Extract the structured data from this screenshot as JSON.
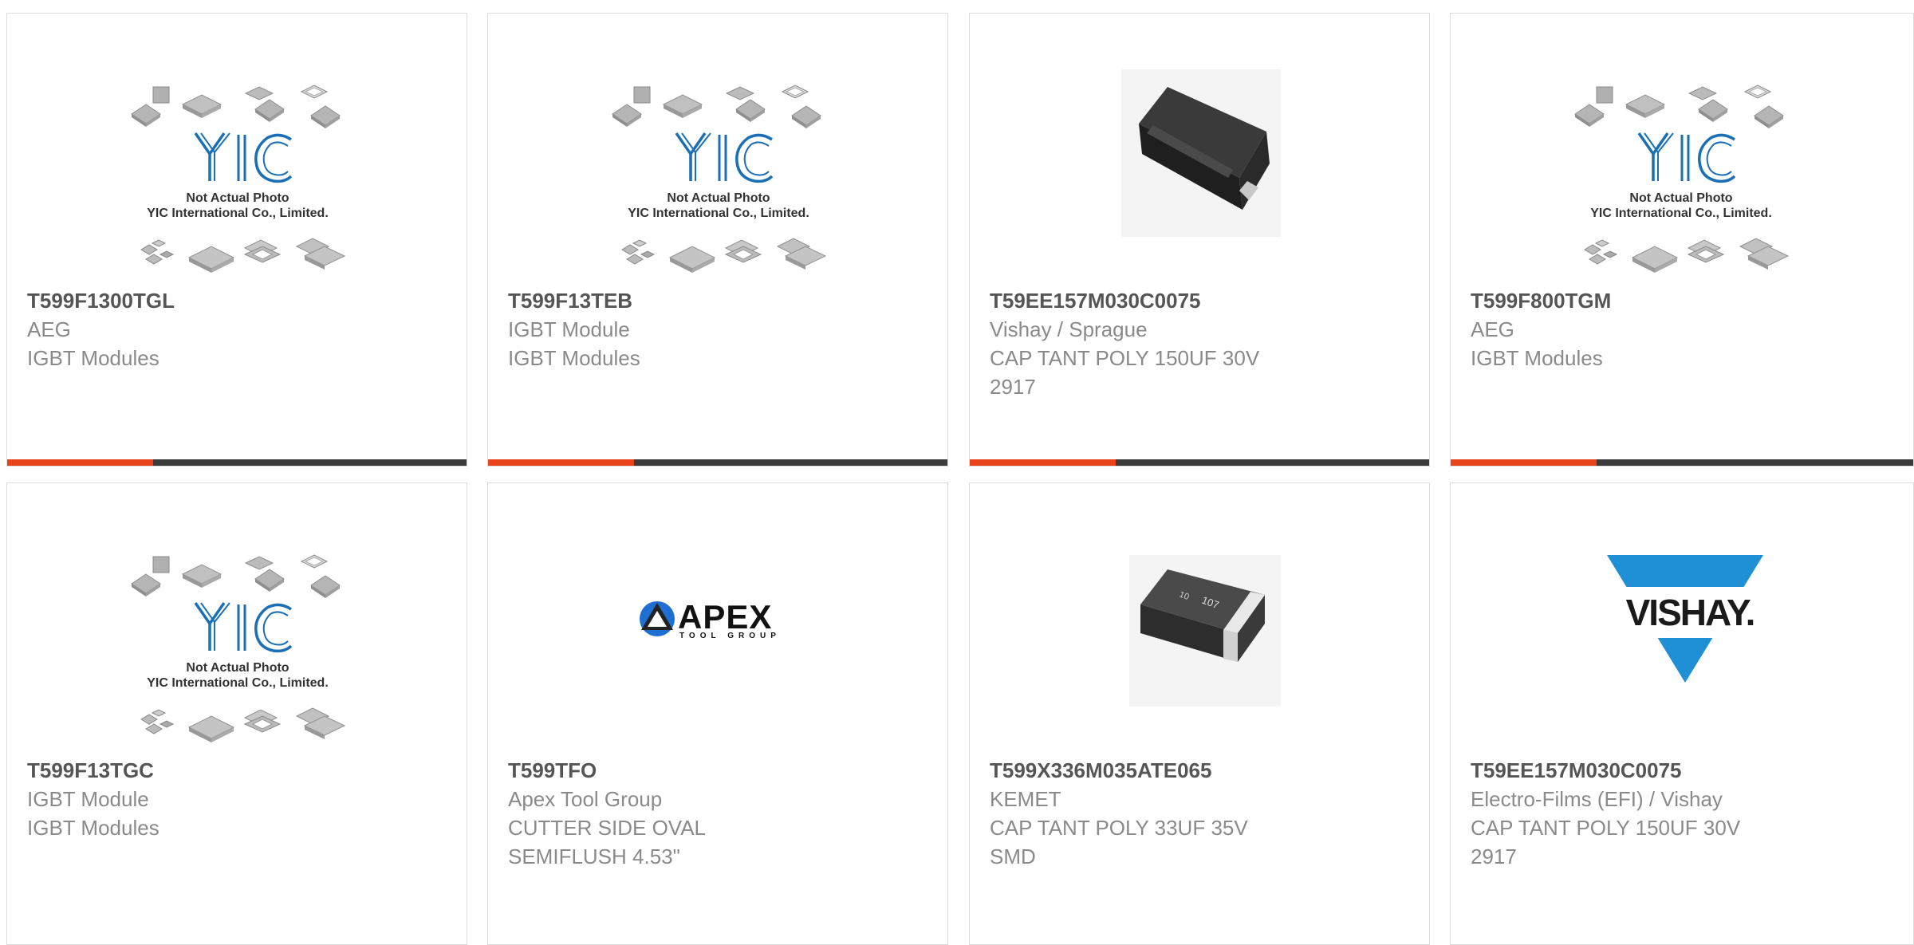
{
  "placeholder": {
    "caption1": "Not Actual Photo",
    "caption2": "YIC International Co., Limited."
  },
  "logos": {
    "apex_word": "APEX",
    "apex_sub": "TOOL GROUP",
    "vishay_word": "VISHAY."
  },
  "colors": {
    "accent": "#e8421a",
    "bar_dark": "#3b3b3b",
    "yic_blue": "#1a6fb5",
    "vishay_blue": "#1f8fd6"
  },
  "products": [
    {
      "part": "T599F1300TGL",
      "line1": "AEG",
      "line2": "IGBT Modules",
      "line3": "",
      "image": "yic-placeholder"
    },
    {
      "part": "T599F13TEB",
      "line1": "IGBT Module",
      "line2": "IGBT Modules",
      "line3": "",
      "image": "yic-placeholder"
    },
    {
      "part": "T59EE157M030C0075",
      "line1": "Vishay / Sprague",
      "line2": "CAP TANT POLY 150UF 30V",
      "line3": "2917",
      "image": "black-smd-capacitor"
    },
    {
      "part": "T599F800TGM",
      "line1": "AEG",
      "line2": "IGBT Modules",
      "line3": "",
      "image": "yic-placeholder"
    },
    {
      "part": "T599F13TGC",
      "line1": "IGBT Module",
      "line2": "IGBT Modules",
      "line3": "",
      "image": "yic-placeholder"
    },
    {
      "part": "T599TFO",
      "line1": "Apex Tool Group",
      "line2": "CUTTER SIDE OVAL",
      "line3": "SEMIFLUSH 4.53\"",
      "image": "apex-logo"
    },
    {
      "part": "T599X336M035ATE065",
      "line1": "KEMET",
      "line2": "CAP TANT POLY 33UF 35V",
      "line3": "SMD",
      "image": "tantalum-capacitor"
    },
    {
      "part": "T59EE157M030C0075",
      "line1": "Electro-Films (EFI) / Vishay",
      "line2": "CAP TANT POLY 150UF 30V",
      "line3": "2917",
      "image": "vishay-logo"
    }
  ]
}
